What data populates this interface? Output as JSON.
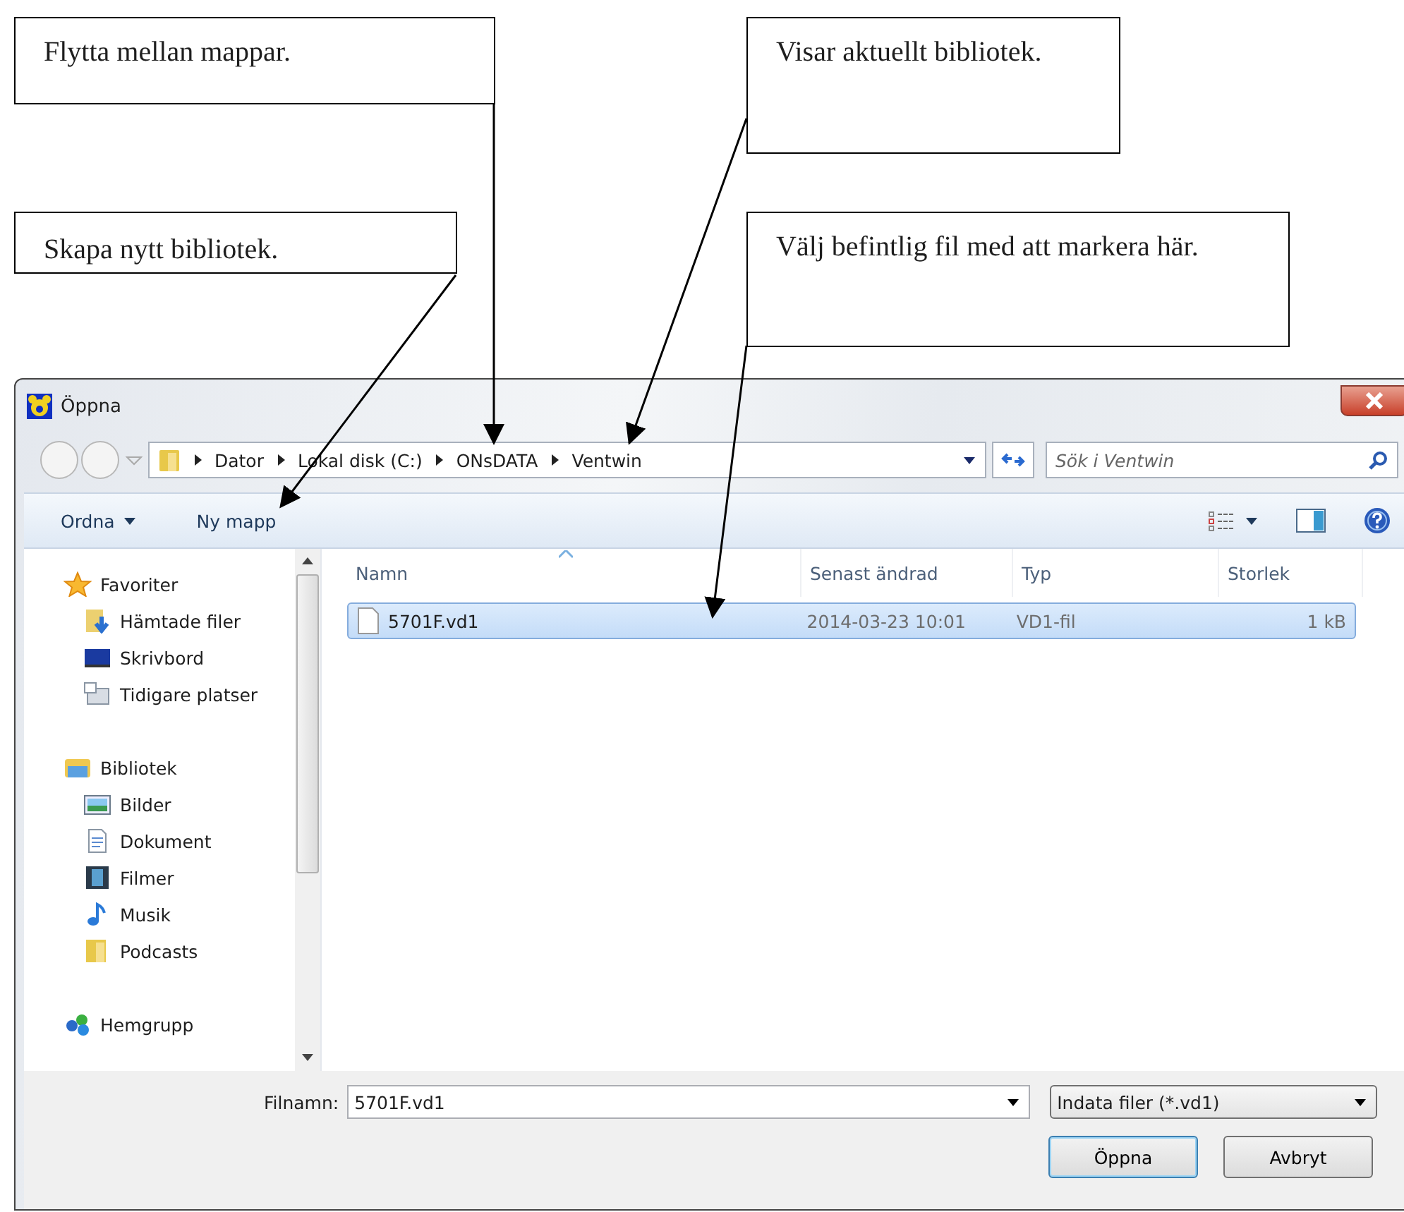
{
  "callouts": [
    {
      "text": "Flytta mellan mappar."
    },
    {
      "text": "Visar aktuellt bibliotek."
    },
    {
      "text": "Skapa nytt bibliotek."
    },
    {
      "text": "Välj befintlig fil med att markera här."
    }
  ],
  "dialog": {
    "title": "Öppna",
    "breadcrumb": [
      "Dator",
      "Lokal disk (C:)",
      "ONsDATA",
      "Ventwin"
    ],
    "search": {
      "placeholder": "Sök i Ventwin"
    },
    "toolbar": {
      "organize": "Ordna",
      "new_folder": "Ny mapp"
    },
    "sidebar": [
      {
        "label": "Favoriter",
        "kind": "star",
        "children": [
          {
            "label": "Hämtade filer",
            "kind": "download"
          },
          {
            "label": "Skrivbord",
            "kind": "desktop"
          },
          {
            "label": "Tidigare platser",
            "kind": "recent"
          }
        ]
      },
      {
        "label": "Bibliotek",
        "kind": "library",
        "children": [
          {
            "label": "Bilder",
            "kind": "pictures"
          },
          {
            "label": "Dokument",
            "kind": "document"
          },
          {
            "label": "Filmer",
            "kind": "film"
          },
          {
            "label": "Musik",
            "kind": "music"
          },
          {
            "label": "Podcasts",
            "kind": "folder"
          }
        ]
      },
      {
        "label": "Hemgrupp",
        "kind": "homegroup"
      }
    ],
    "columns": [
      "Namn",
      "Senast ändrad",
      "Typ",
      "Storlek"
    ],
    "files": [
      {
        "name": "5701F.vd1",
        "modified": "2014-03-23 10:01",
        "type": "VD1-fil",
        "size": "1 kB",
        "selected": true
      }
    ],
    "filename": {
      "label": "Filnamn:",
      "value": "5701F.vd1"
    },
    "filter": "Indata filer (*.vd1)",
    "buttons": [
      {
        "label": "Öppna",
        "default": true
      },
      {
        "label": "Avbryt",
        "default": false
      }
    ]
  }
}
